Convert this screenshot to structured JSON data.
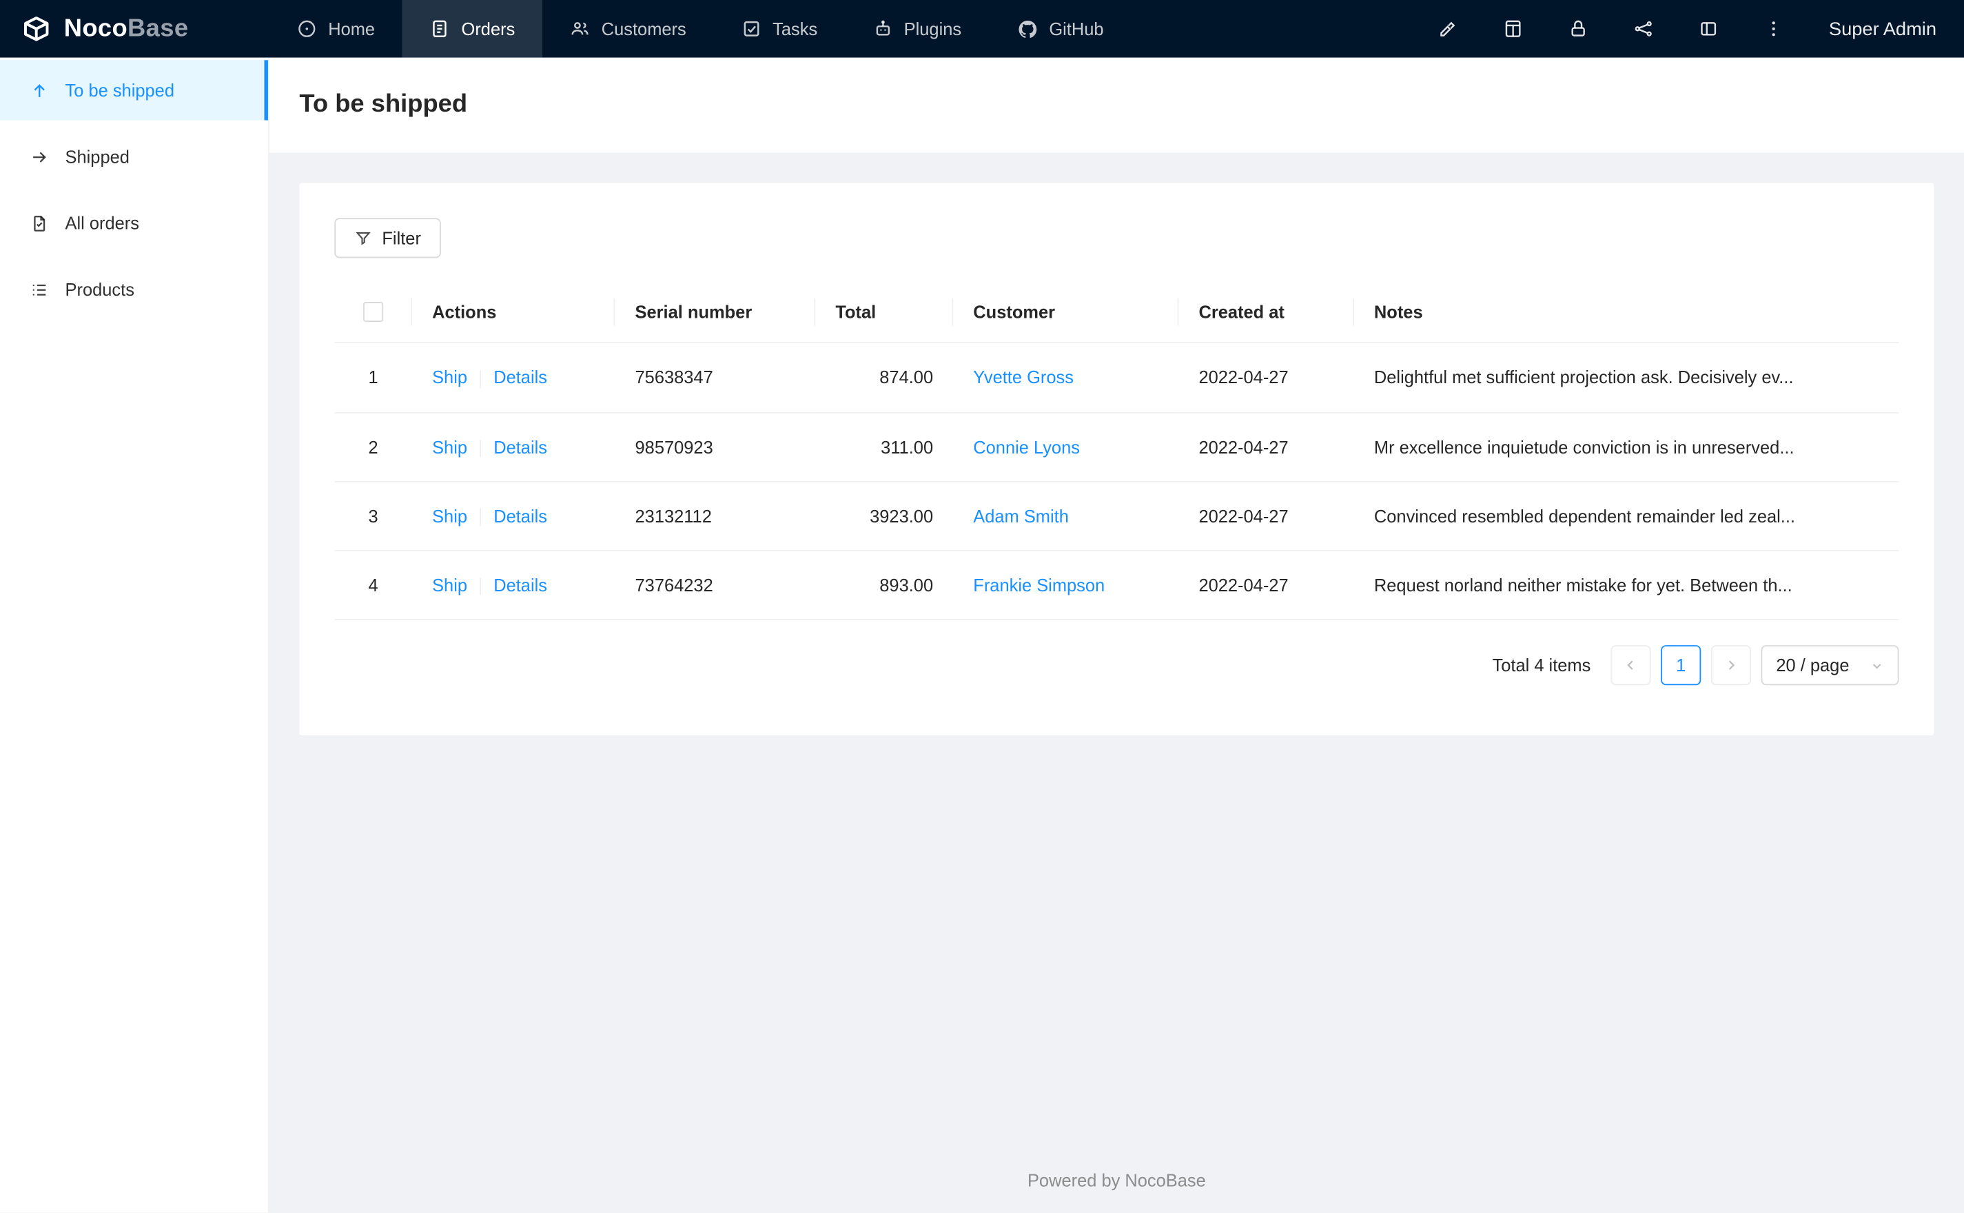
{
  "colors": {
    "accent": "#1890ff",
    "topbar_bg": "#001529",
    "page_bg": "#f0f2f5",
    "active_menu_bg": "#e6f7ff",
    "link": "#1890ff"
  },
  "topbar": {
    "brand": {
      "bold": "Noco",
      "light": "Base"
    },
    "nav": [
      {
        "label": "Home",
        "icon": "home-icon"
      },
      {
        "label": "Orders",
        "icon": "orders-icon"
      },
      {
        "label": "Customers",
        "icon": "customers-icon"
      },
      {
        "label": "Tasks",
        "icon": "tasks-icon"
      },
      {
        "label": "Plugins",
        "icon": "plugins-icon"
      },
      {
        "label": "GitHub",
        "icon": "github-icon"
      }
    ],
    "action_icons": [
      "highlighter-icon",
      "collections-icon",
      "lock-icon",
      "api-graph-icon",
      "layout-icon",
      "more-icon"
    ],
    "user": "Super Admin"
  },
  "sidebar": {
    "items": [
      {
        "label": "To be shipped",
        "icon": "arrow-up-icon",
        "active": true
      },
      {
        "label": "Shipped",
        "icon": "arrow-right-icon",
        "active": false
      },
      {
        "label": "All orders",
        "icon": "file-icon",
        "active": false
      },
      {
        "label": "Products",
        "icon": "list-icon",
        "active": false
      }
    ]
  },
  "page": {
    "title": "To be shipped"
  },
  "toolbar": {
    "filter_label": "Filter"
  },
  "table": {
    "columns": [
      "Actions",
      "Serial number",
      "Total",
      "Customer",
      "Created at",
      "Notes"
    ],
    "rows": [
      {
        "index": "1",
        "ship": "Ship",
        "details": "Details",
        "serial": "75638347",
        "total": "874.00",
        "customer": "Yvette Gross",
        "created_at": "2022-04-27",
        "notes": "Delightful met sufficient projection ask. Decisively ev..."
      },
      {
        "index": "2",
        "ship": "Ship",
        "details": "Details",
        "serial": "98570923",
        "total": "311.00",
        "customer": "Connie Lyons",
        "created_at": "2022-04-27",
        "notes": "Mr excellence inquietude conviction is in unreserved..."
      },
      {
        "index": "3",
        "ship": "Ship",
        "details": "Details",
        "serial": "23132112",
        "total": "3923.00",
        "customer": "Adam Smith",
        "created_at": "2022-04-27",
        "notes": "Convinced resembled dependent remainder led zeal..."
      },
      {
        "index": "4",
        "ship": "Ship",
        "details": "Details",
        "serial": "73764232",
        "total": "893.00",
        "customer": "Frankie Simpson",
        "created_at": "2022-04-27",
        "notes": "Request norland neither mistake for yet. Between th..."
      }
    ]
  },
  "pagination": {
    "total_text": "Total 4 items",
    "current_page": "1",
    "page_size": "20 / page"
  },
  "footer": {
    "text": "Powered by NocoBase"
  }
}
